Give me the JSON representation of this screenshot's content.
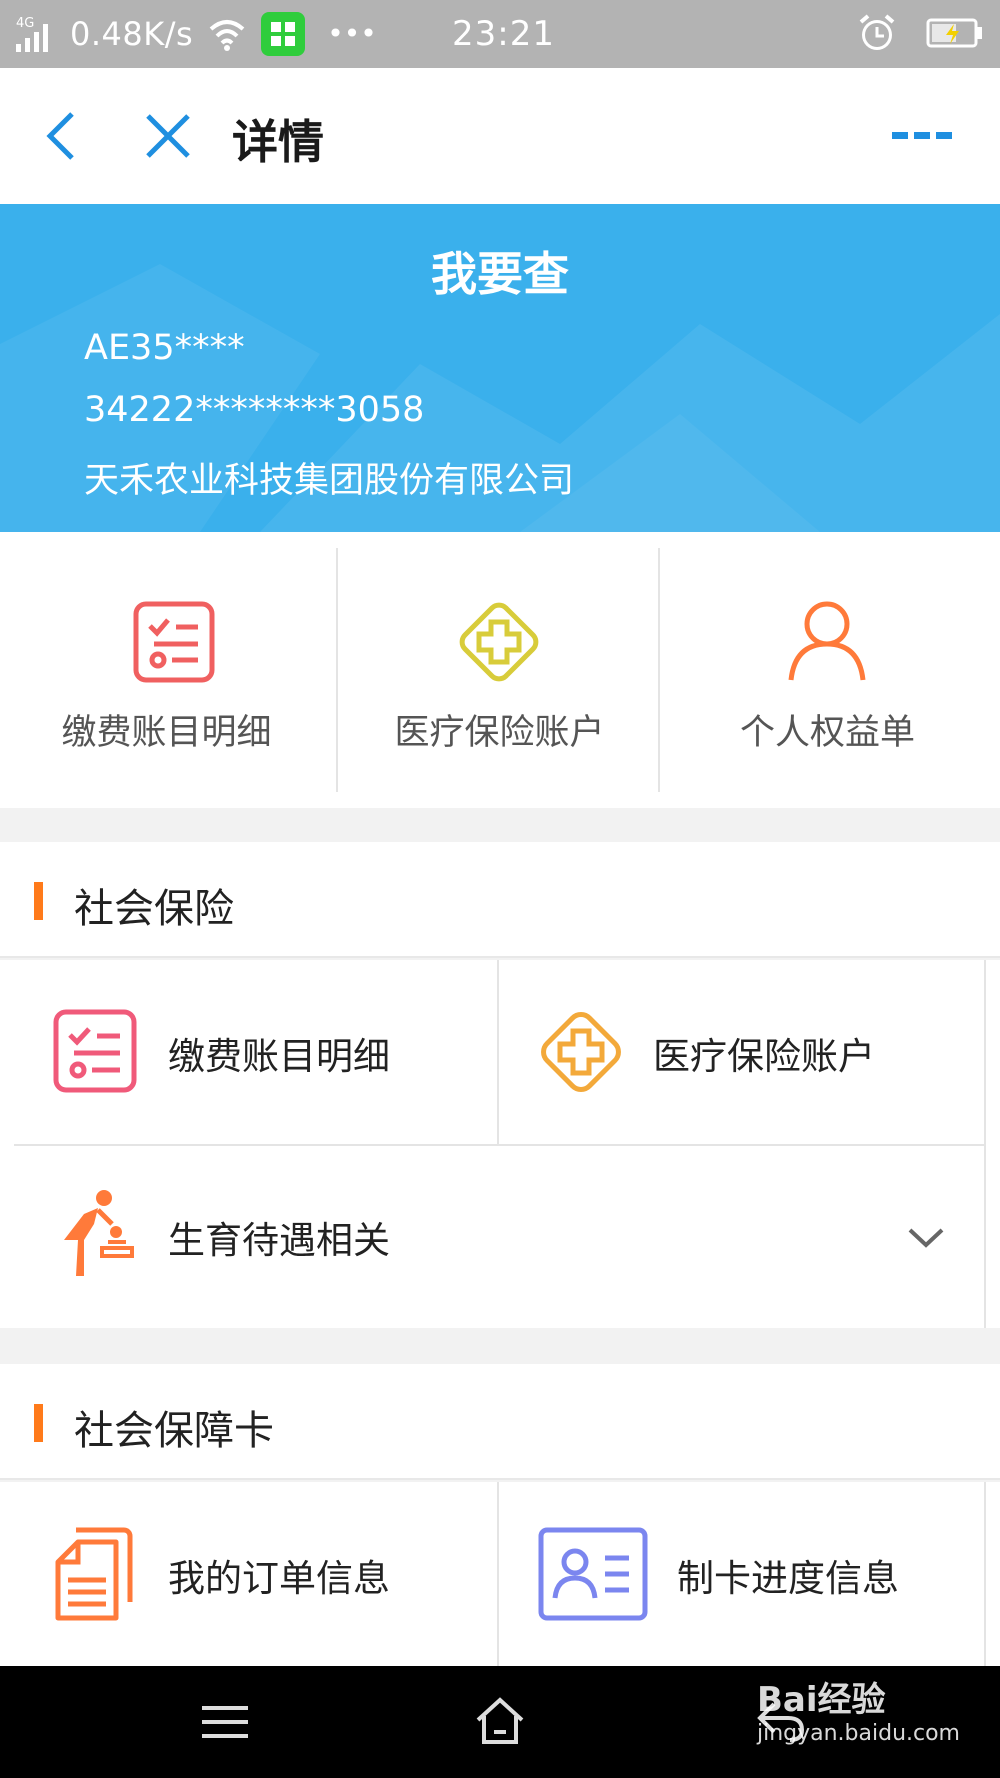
{
  "status_bar": {
    "network": "4G",
    "speed": "0.48K/s",
    "more": "•••",
    "time": "23:21"
  },
  "nav": {
    "title": "详情"
  },
  "banner": {
    "title": "我要查",
    "account_no": "AE35****",
    "id_no": "34222********3058",
    "company": "天禾农业科技集团股份有限公司",
    "color": "#3ab0ec"
  },
  "quick_actions": [
    {
      "label": "缴费账目明细",
      "icon": "checklist-icon",
      "color": "#f06060"
    },
    {
      "label": "医疗保险账户",
      "icon": "medical-cross-icon",
      "color": "#d8cc3a"
    },
    {
      "label": "个人权益单",
      "icon": "person-icon",
      "color": "#ff7a3a"
    }
  ],
  "social_insurance": {
    "title": "社会保险",
    "items": [
      {
        "label": "缴费账目明细",
        "icon": "checklist-icon",
        "color": "#f05a7a"
      },
      {
        "label": "医疗保险账户",
        "icon": "medical-cross-icon",
        "color": "#f3a93a"
      }
    ],
    "maternity": {
      "label": "生育待遇相关",
      "icon": "maternity-icon",
      "color": "#ff7a3a"
    }
  },
  "social_card": {
    "title": "社会保障卡",
    "items": [
      {
        "label": "我的订单信息",
        "icon": "document-icon",
        "color": "#ff7a3a"
      },
      {
        "label": "制卡进度信息",
        "icon": "id-card-icon",
        "color": "#7b86ef"
      }
    ]
  },
  "watermark": {
    "brand": "Bai经验",
    "url": "jingyan.baidu.com"
  }
}
